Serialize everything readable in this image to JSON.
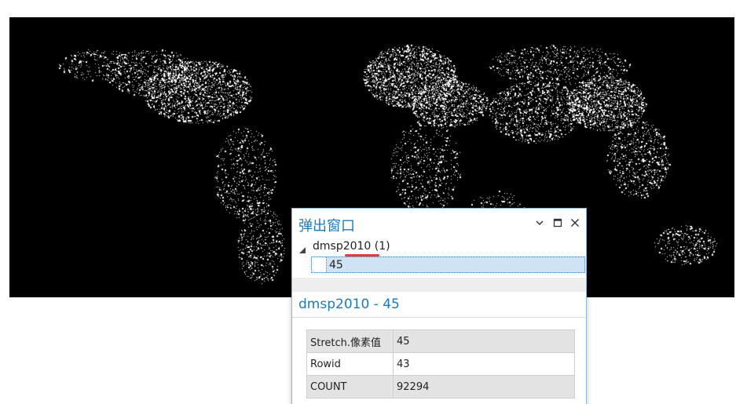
{
  "popup": {
    "title": "弹出窗口",
    "controls": {
      "dropdown_icon": "chevron-down-icon",
      "maximize_icon": "maximize-icon",
      "close_icon": "close-icon"
    },
    "layer": {
      "label": "dmsp2010 (1)",
      "expanded": true
    },
    "selected_feature": "45",
    "section_title": "dmsp2010 - 45",
    "attributes": [
      {
        "field": "Stretch.像素值",
        "value": "45"
      },
      {
        "field": "Rowid",
        "value": "43"
      },
      {
        "field": "COUNT",
        "value": "92294"
      }
    ]
  },
  "colors": {
    "accent": "#1f7ab8",
    "map_background": "#000000",
    "lights": "#ffffff",
    "highlight_mark": "#e23b3b",
    "selection_fill": "#cfe3f4"
  }
}
